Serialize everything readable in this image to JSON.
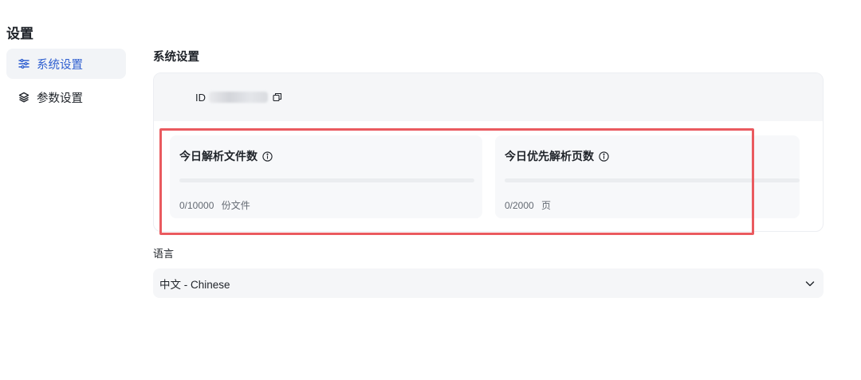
{
  "sidebar": {
    "title": "设置",
    "items": [
      {
        "label": "系统设置",
        "icon": "sliders-icon",
        "active": true
      },
      {
        "label": "参数设置",
        "icon": "layers-icon",
        "active": false
      }
    ]
  },
  "main": {
    "section_title": "系统设置",
    "account": {
      "id_label": "ID"
    },
    "stats": [
      {
        "title": "今日解析文件数",
        "value": "0/10000",
        "unit": "份文件",
        "progress": 0
      },
      {
        "title": "今日优先解析页数",
        "value": "0/2000",
        "unit": "页",
        "progress": 0
      }
    ],
    "language": {
      "label": "语言",
      "selected": "中文 - Chinese"
    }
  },
  "colors": {
    "accent": "#2f5fd0",
    "highlight_border": "#ea5a5f",
    "panel_bg": "#f5f6f8"
  }
}
